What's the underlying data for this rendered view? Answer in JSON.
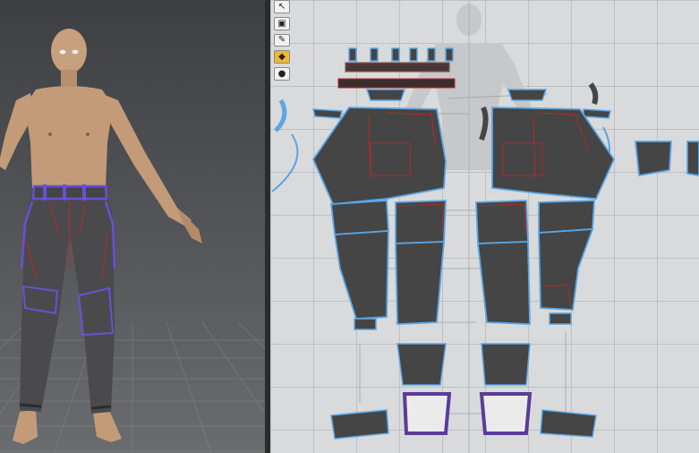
{
  "app": {
    "views": [
      "3d",
      "2d"
    ]
  },
  "toolbar": {
    "tools": [
      {
        "name": "select-tool",
        "icon": "arrow-icon",
        "glyph": "↖"
      },
      {
        "name": "transform-tool",
        "icon": "box-icon",
        "glyph": "▣"
      },
      {
        "name": "edit-tool",
        "icon": "pen-icon",
        "glyph": "✎"
      },
      {
        "name": "sew-tool",
        "icon": "needle-icon",
        "glyph": "◆"
      },
      {
        "name": "pin-tool",
        "icon": "pin-icon",
        "glyph": "●"
      }
    ]
  },
  "colors": {
    "panel_fill": "#454545",
    "seam_outline": "#5aa6e6",
    "topstitch": "#b8282c",
    "waistband_outline": "#6a4fd8",
    "pocket_trim": "#5a3c96",
    "skin": "#c7a07d"
  }
}
